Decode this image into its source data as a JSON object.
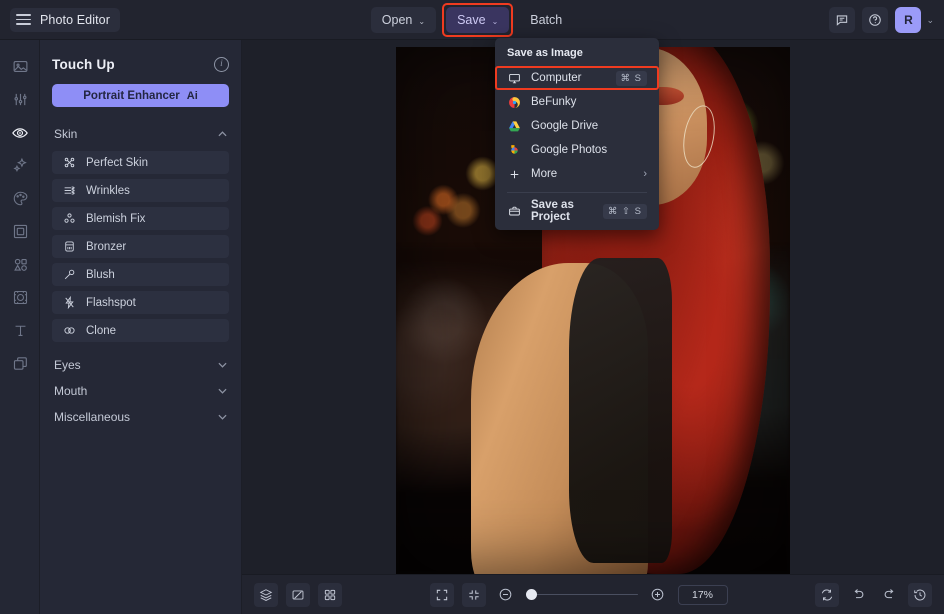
{
  "app": {
    "title": "Photo Editor",
    "accent": "#8e8ef6",
    "highlight": "#f03b20",
    "panel_bg": "#252836",
    "canvas_bg": "#1e2029"
  },
  "topbar": {
    "menu_icon": "hamburger-icon",
    "open_label": "Open",
    "save_label": "Save",
    "batch_label": "Batch",
    "caret": "⌄",
    "feedback_icon": "comment-icon",
    "help_icon": "question-circle-icon",
    "avatar_initial": "R",
    "avatar_caret": "⌄"
  },
  "rail": {
    "items": [
      {
        "name": "image-icon",
        "active": false
      },
      {
        "name": "adjust-sliders-icon",
        "active": false
      },
      {
        "name": "touch-up-eye-icon",
        "active": true
      },
      {
        "name": "effects-sparkle-icon",
        "active": false
      },
      {
        "name": "artsy-palette-icon",
        "active": false
      },
      {
        "name": "frames-icon",
        "active": false
      },
      {
        "name": "graphics-shapes-icon",
        "active": false
      },
      {
        "name": "overlays-icon",
        "active": false
      },
      {
        "name": "text-icon",
        "active": false
      },
      {
        "name": "layers-icon",
        "active": false
      }
    ]
  },
  "panel": {
    "title": "Touch Up",
    "info_icon": "info-icon",
    "info_glyph": "i",
    "enhancer_label": "Portrait Enhancer",
    "enhancer_badge": "Ai",
    "groups": [
      {
        "label": "Skin",
        "expanded": true,
        "chevron": "⌃",
        "tools": [
          {
            "label": "Perfect Skin",
            "icon": "perfect-skin-icon"
          },
          {
            "label": "Wrinkles",
            "icon": "wrinkles-icon"
          },
          {
            "label": "Blemish Fix",
            "icon": "blemish-fix-icon"
          },
          {
            "label": "Bronzer",
            "icon": "bronzer-icon"
          },
          {
            "label": "Blush",
            "icon": "blush-icon"
          },
          {
            "label": "Flashspot",
            "icon": "flashspot-icon"
          },
          {
            "label": "Clone",
            "icon": "clone-icon"
          }
        ]
      },
      {
        "label": "Eyes",
        "expanded": false,
        "chevron": "⌄",
        "tools": []
      },
      {
        "label": "Mouth",
        "expanded": false,
        "chevron": "⌄",
        "tools": []
      },
      {
        "label": "Miscellaneous",
        "expanded": false,
        "chevron": "⌄",
        "tools": []
      }
    ]
  },
  "save_menu": {
    "section_label": "Save as Image",
    "items": [
      {
        "label": "Computer",
        "icon": "monitor-icon",
        "shortcut": "⌘ S",
        "highlighted": true,
        "arrow": ""
      },
      {
        "label": "BeFunky",
        "icon": "befunky-logo-icon",
        "shortcut": "",
        "highlighted": false,
        "arrow": ""
      },
      {
        "label": "Google Drive",
        "icon": "google-drive-icon",
        "shortcut": "",
        "highlighted": false,
        "arrow": ""
      },
      {
        "label": "Google Photos",
        "icon": "google-photos-icon",
        "shortcut": "",
        "highlighted": false,
        "arrow": ""
      },
      {
        "label": "More",
        "icon": "plus-icon",
        "shortcut": "",
        "highlighted": false,
        "arrow": "›"
      }
    ],
    "project_item": {
      "label": "Save as Project",
      "icon": "briefcase-icon",
      "shortcut": "⌘ ⇧ S"
    }
  },
  "bottombar": {
    "left_tools": [
      {
        "name": "layers-stack-icon"
      },
      {
        "name": "compare-icon"
      },
      {
        "name": "grid-view-icon"
      }
    ],
    "fit_icon": "fit-screen-icon",
    "actual_icon": "shrink-icon",
    "zoom_out_icon": "minus-circle-icon",
    "zoom_in_icon": "plus-circle-icon",
    "zoom_value": "17%",
    "zoom_percent": 17,
    "right_tools": [
      {
        "name": "reset-icon"
      },
      {
        "name": "undo-icon"
      },
      {
        "name": "redo-icon"
      },
      {
        "name": "history-icon"
      }
    ]
  }
}
